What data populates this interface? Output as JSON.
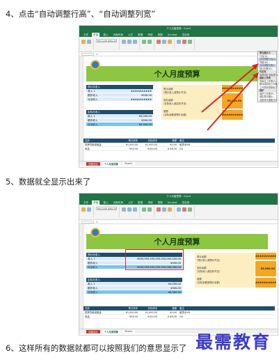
{
  "steps": {
    "step4": "4、点击“自动调整行高”、“自动调整列宽”",
    "step5": "5、数据就全显示出来了",
    "step6": "6、这样所有的数据就都可以按照我们的意思显示了"
  },
  "excel": {
    "window_title": "个人月度预算 - Excel",
    "tabs": [
      "文件",
      "开始",
      "插入",
      "页面布局",
      "公式",
      "数据",
      "审阅",
      "视图",
      "Acrobat",
      "告诉我"
    ],
    "active_tab": "开始",
    "font_name": "Microsoft YaHei UI",
    "sheet_title": "个人月度预算",
    "income_header": "预计月收入",
    "income_rows": [
      {
        "label": "收入 1",
        "value1": "##########",
        "value2": "¥555,555,555,555,555,000,000.00"
      },
      {
        "label": "额外收入",
        "value1": "¥500.00",
        "value2": "¥500.00"
      },
      {
        "label": "月总收入",
        "value1": "##########",
        "value2": "¥555,555,555,555,555,000,000.00"
      }
    ],
    "actual_header": "实际月收入",
    "actual_rows": [
      {
        "label": "收入 1",
        "value": "¥4,000.00"
      },
      {
        "label": "额外收入",
        "value": "¥300.00"
      },
      {
        "label": "月总收入",
        "value": "¥4,300.00"
      }
    ],
    "balance": {
      "projected_label": "预计余额",
      "projected_note": "(预计收入减预计开支)",
      "projected_value": "##########",
      "actual_label": "实际余额",
      "actual_note": "(实际收入减实际开支)",
      "actual_value": "¥3,964.00",
      "diff_label": "差额",
      "diff_note": "(实际余额减预计余额)",
      "diff_value": "##########"
    },
    "table_headers": [
      "住房",
      "预计成本",
      "实际成本",
      "差额",
      "备注"
    ],
    "table_rows": [
      {
        "c1": "抵押贷款或租金",
        "c2": "¥1,000.00",
        "c3": "¥1,000.00",
        "c4": "¥0.00",
        "c5": "租赁/DVD"
      },
      {
        "c1": "电话",
        "c2": "¥54.00",
        "c3": "¥100.00",
        "c4": "¥-46.00",
        "c5": "CD"
      }
    ],
    "sheet_tabs": [
      "月度支出",
      "个人月度预算",
      "Sheet1"
    ],
    "menu_title": "单元格大小",
    "menu_items": [
      "行高(H)...",
      "自动调整行高(A)",
      "列宽(W)...",
      "自动调整列宽(I)",
      "默认列宽(D)...",
      "可见性",
      "隐藏和取消隐藏(U)",
      "组织工作表",
      "重命名工作表(R)",
      "移动或复制工作表(M)...",
      "工作表标签颜色(T)",
      "保护",
      "保护工作表(P)...",
      "锁定单元格(L)",
      "设置单元格格式(E)..."
    ]
  },
  "watermark": "最需教育",
  "colors": {
    "excel_green": "#217346",
    "header_green": "#8dc641",
    "dark_blue": "#1f4e6b",
    "orange": "#f5a623",
    "red": "#e02020"
  }
}
